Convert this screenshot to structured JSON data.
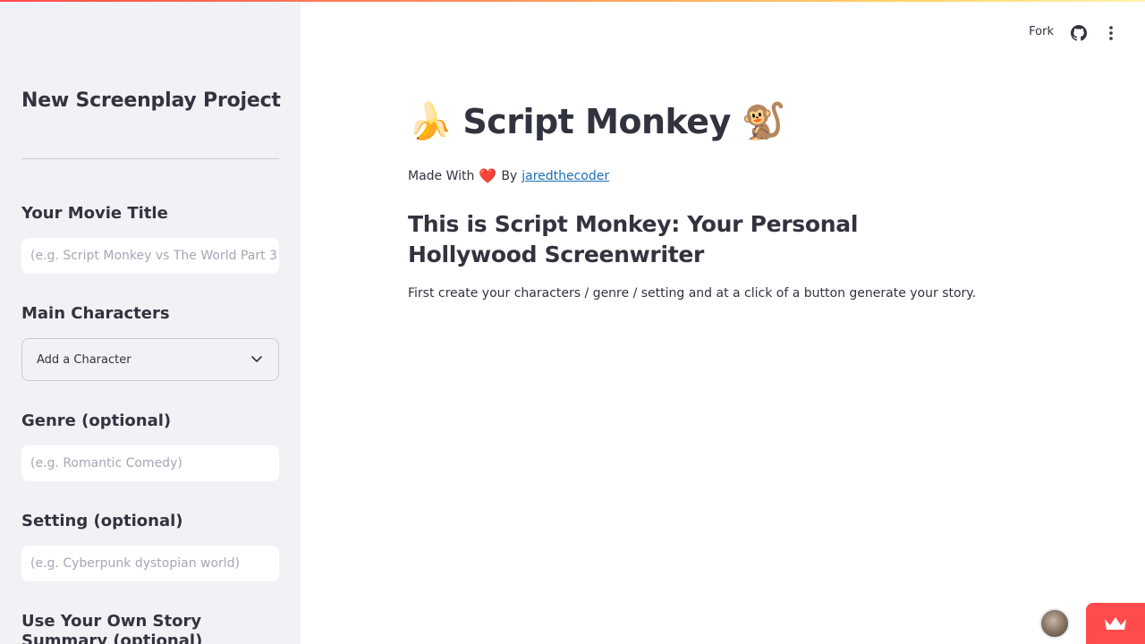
{
  "sidebar": {
    "title": "New Screenplay Project",
    "fields": {
      "movie_title": {
        "label": "Your Movie Title",
        "placeholder": "(e.g. Script Monkey vs The World Part 3)"
      },
      "characters": {
        "label": "Main Characters",
        "selected": "Add a Character"
      },
      "genre": {
        "label": "Genre (optional)",
        "placeholder": "(e.g. Romantic Comedy)"
      },
      "setting": {
        "label": "Setting (optional)",
        "placeholder": "(e.g. Cyberpunk dystopian world)"
      },
      "summary": {
        "label": "Use Your Own Story Summary (optional)"
      }
    }
  },
  "header": {
    "fork_label": "Fork",
    "github_icon": "github-icon",
    "menu_icon": "kebab-menu-icon"
  },
  "main": {
    "title": "Script Monkey",
    "title_emoji_left": "🍌",
    "title_emoji_right": "🐒",
    "made_with_prefix": "Made With",
    "made_with_heart": "❤️",
    "made_with_by": "By",
    "author_link": "jaredthecoder",
    "subheading": "This is Script Monkey: Your Personal Hollywood Screenwriter",
    "description": "First create your characters / genre / setting and at a click of a button generate your story."
  },
  "colors": {
    "accent": "#ff4b4b",
    "sidebar_bg": "#f0f2f6",
    "link": "#1c6fb8",
    "text": "#31333f"
  }
}
